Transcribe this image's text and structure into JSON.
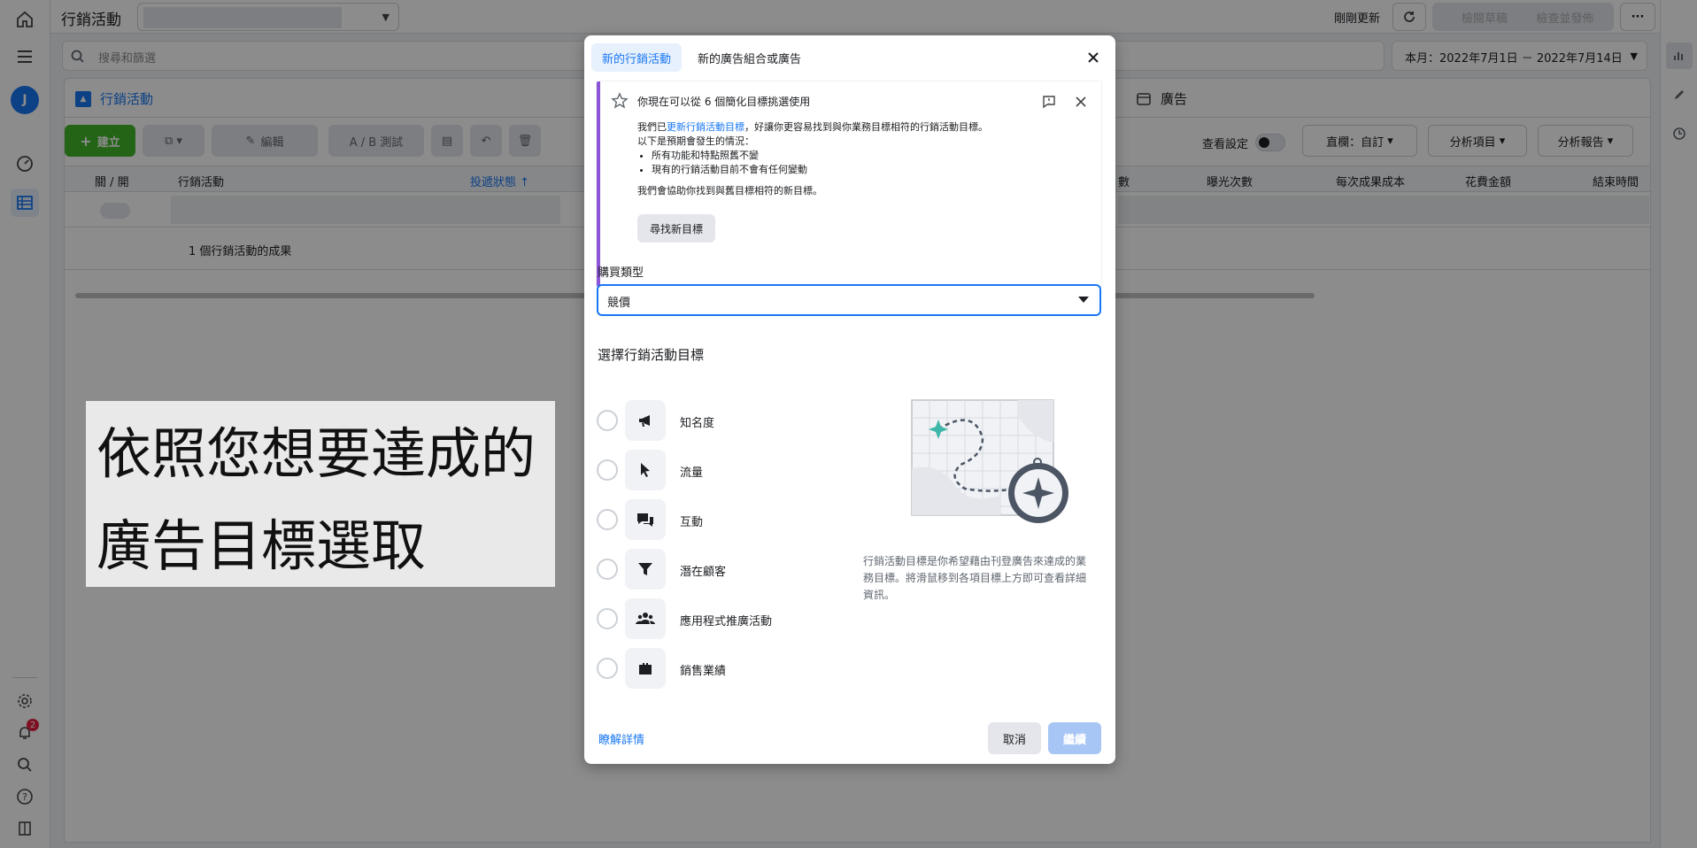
{
  "app": {
    "page_title": "行銷活動",
    "refresh_label": "剛剛更新",
    "review_label": "檢閱草稿",
    "publish_label": "檢查並發佈",
    "more_label": "···",
    "search_placeholder": "搜尋和篩選",
    "date_range": "本月：2022年7月1日 － 2022年7月14日",
    "notification_count": "2",
    "avatar_initial": "J"
  },
  "panel": {
    "tab_campaigns": "行銷活動",
    "tab_ads": "廣告",
    "create_label": "建立",
    "edit_label": "編輯",
    "ab_test_label": "A / B 測試",
    "view_settings_label": "查看設定",
    "columns_label": "直欄：自訂",
    "breakdown_label": "分析項目",
    "reports_label": "分析報告",
    "headers": [
      "關 / 開",
      "行銷活動",
      "投遞狀態 ↑",
      "數",
      "曝光次數",
      "每次成果成本",
      "花費金額",
      "結束時間"
    ],
    "summary_text": "1 個行銷活動的成果"
  },
  "caption": {
    "line1": "依照您想要達成的",
    "line2": "廣告目標選取"
  },
  "modal": {
    "tabs": [
      "新的行銷活動",
      "新的廣告組合或廣告"
    ],
    "notice": {
      "title": "你現在可以從 6 個簡化目標挑選使用",
      "body_prefix": "我們已",
      "body_link": "更新行銷活動目標",
      "body_suffix": "，好讓你更容易找到與你業務目標相符的行銷活動目標。",
      "intro": "以下是預期會發生的情況：",
      "bullets": [
        "所有功能和特點照舊不變",
        "現有的行銷活動目前不會有任何變動"
      ],
      "closing": "我們會協助你找到與舊目標相符的新目標。",
      "button": "尋找新目標"
    },
    "buy_type_label": "購買類型",
    "buy_type_value": "競價",
    "objective_heading": "選擇行銷活動目標",
    "objectives": [
      {
        "label": "知名度",
        "icon": "megaphone-icon"
      },
      {
        "label": "流量",
        "icon": "cursor-icon"
      },
      {
        "label": "互動",
        "icon": "chat-bubbles-icon"
      },
      {
        "label": "潛在顧客",
        "icon": "funnel-icon"
      },
      {
        "label": "應用程式推廣活動",
        "icon": "people-icon"
      },
      {
        "label": "銷售業績",
        "icon": "briefcase-icon"
      }
    ],
    "helper_text": "行銷活動目標是你希望藉由刊登廣告來達成的業務目標。將滑鼠移到各項目標上方即可查看詳細資訊。",
    "learn_more": "瞭解詳情",
    "cancel": "取消",
    "continue": "繼續"
  },
  "colors": {
    "accent": "#1877f2",
    "create_green": "#42b72a",
    "notice_bar": "#8b55d6",
    "badge_red": "#e41e3f"
  }
}
